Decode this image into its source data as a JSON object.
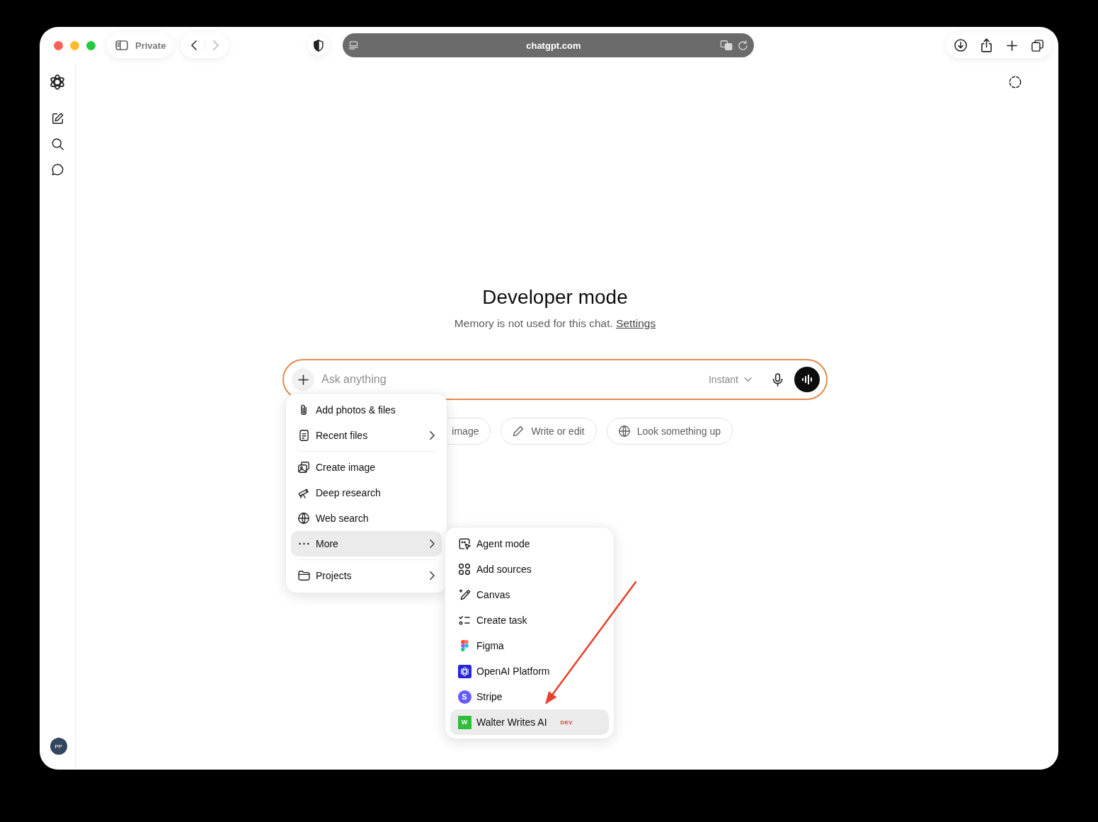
{
  "browser": {
    "mode_label": "Private",
    "back": {
      "disabled": false
    },
    "forward": {
      "disabled": true
    },
    "url": "chatgpt.com"
  },
  "sidebar": {
    "avatar_initials": "PP"
  },
  "intro": {
    "title": "Developer mode",
    "subtitle": "Memory is not used for this chat.",
    "link": "Settings"
  },
  "composer": {
    "placeholder": "Ask anything",
    "model": "Instant"
  },
  "suggestions": [
    {
      "label": "image"
    },
    {
      "label": "Write or edit"
    },
    {
      "label": "Look something up"
    }
  ],
  "plus_menu": {
    "sections": [
      {
        "items": [
          {
            "label": "Add photos & files",
            "submenu": false,
            "selected": false
          },
          {
            "label": "Recent files",
            "submenu": true,
            "selected": false
          }
        ]
      },
      {
        "items": [
          {
            "label": "Create image",
            "submenu": false,
            "selected": false
          },
          {
            "label": "Deep research",
            "submenu": false,
            "selected": false
          },
          {
            "label": "Web search",
            "submenu": false,
            "selected": false
          },
          {
            "label": "More",
            "submenu": true,
            "selected": true
          }
        ]
      },
      {
        "items": [
          {
            "label": "Projects",
            "submenu": true,
            "selected": false
          }
        ]
      }
    ]
  },
  "more_menu": {
    "items": [
      {
        "label": "Agent mode",
        "selected": false
      },
      {
        "label": "Add sources",
        "selected": false
      },
      {
        "label": "Canvas",
        "selected": false
      },
      {
        "label": "Create task",
        "selected": false
      },
      {
        "label": "Figma",
        "selected": false
      },
      {
        "label": "OpenAI Platform",
        "selected": false
      },
      {
        "label": "Stripe",
        "selected": false,
        "logo": {
          "letter": "S",
          "color": "#635bff",
          "round": true
        }
      },
      {
        "label": "Walter Writes AI",
        "selected": true,
        "logo": {
          "letter": "W",
          "color": "#2dbe3a",
          "round": false
        },
        "badge": "DEV"
      }
    ]
  }
}
